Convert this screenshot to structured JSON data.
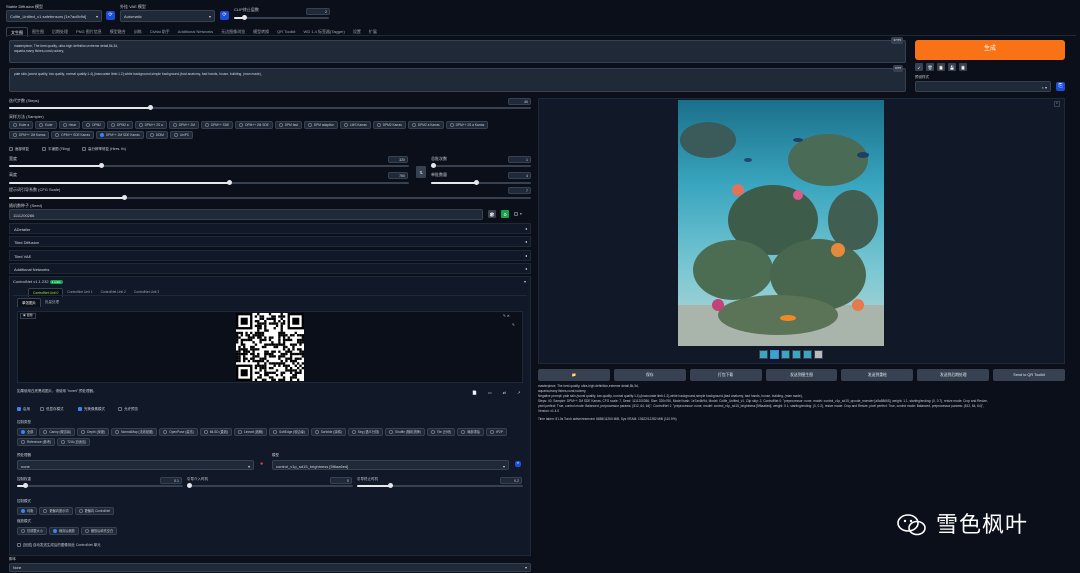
{
  "top": {
    "checkpoint_label": "Stable Diffusion 模型",
    "checkpoint_value": "Colife_Unified_v1.safetensors [1e7ac6b9d]",
    "vae_label": "外挂 VAE 模型",
    "vae_value": "Automatic",
    "clip_label": "CLIP终止层数",
    "clip_value": "2"
  },
  "tabs": [
    "文生图",
    "图生图",
    "后期处理",
    "PNG 图片信息",
    "模型融合",
    "训练",
    "Civitai 助手",
    "Additional Networks",
    "无边图像浏览",
    "模型转换",
    "QR Toolkit",
    "WD 1.4 标签器(Tagger)",
    "设置",
    "扩展"
  ],
  "prompt": {
    "positive": "masterpiece, The best quality, ultra-high definition,extreme detail,8k,3d,\naquaria,many fishes,coral,rockery,",
    "positive_count": "37/75",
    "negative": "pale skin,(worst quality, low quality, normal quality:1.4),(inaccurate limb:1.2),white background,simple background,(bad anatomy, bad hands, house, building, (man made),",
    "negative_count": "0/75",
    "generate": "生成",
    "style_label": "预设样式",
    "tool_icons": [
      "↙",
      "🗑",
      "📋",
      "💾",
      "📋"
    ]
  },
  "params": {
    "steps_label": "迭代步数 (Steps)",
    "steps_value": "40",
    "steps_ratio": 0.27,
    "sampler_label": "采样方法 (Sampler)",
    "samplers": [
      "Euler a",
      "Euler",
      "Heun",
      "DPM2",
      "DPM2 a",
      "DPM++ 2S a",
      "DPM++ 2M",
      "DPM++ SDE",
      "DPM++ 2M SDE",
      "DPM fast",
      "DPM adaptive",
      "LMS Karras",
      "DPM2 Karras",
      "DPM2 a Karras",
      "DPM++ 2S a Karras",
      "DPM++ 2M Karras",
      "DPM++ SDE Karras",
      "DPM++ 2M SDE Karras",
      "DDIM",
      "UniPC"
    ],
    "sampler_selected": "DPM++ 2M SDE Karras",
    "face_fix": "面部修复",
    "tiling": "平铺图 (Tiling)",
    "hires": "高分辨率修复 (Hires. fix)",
    "width_label": "宽度",
    "width_value": "320",
    "width_ratio": 0.23,
    "height_label": "高度",
    "height_value": "760",
    "height_ratio": 0.55,
    "batch_count_label": "总批次数",
    "batch_count_value": "1",
    "batch_size_label": "单批数量",
    "batch_size_value": "4",
    "batch_size_ratio": 0.45,
    "cfg_label": "提示词引导系数 (CFG Scale)",
    "cfg_value": "7",
    "cfg_ratio": 0.22,
    "seed_label": "随机数种子 (Seed)",
    "seed_value": "1111200286"
  },
  "accordions": [
    "ADetailer",
    "Tiled Diffusion",
    "Tiled VAE",
    "Additional Networks"
  ],
  "controlnet": {
    "title": "ControlNet v1.1.232",
    "badge": "1 units",
    "units": [
      "ControlNet Unit 0",
      "ControlNet Unit 1",
      "ControlNet Unit 2",
      "ControlNet Unit 3"
    ],
    "subtabs": [
      "单张图片",
      "批量处理"
    ],
    "image_label": "图像",
    "hint": "如果使用白底黑线图片，请使用 \"invert\" 预处理器。",
    "enable": "启用",
    "lowvram": "低显存模式",
    "pixel_perfect": "完美像素模式",
    "allow_preview": "允许预览",
    "control_type_label": "控制类型",
    "control_types": [
      "全部",
      "Canny (硬边缘)",
      "Depth (深度)",
      "NormalMap (法线贴图)",
      "OpenPose (姿态)",
      "MLSD (直线)",
      "Lineart (线稿)",
      "SoftEdge (软边缘)",
      "Scribble (涂鸦)",
      "Seg (语义分割)",
      "Shuffle (随机洗牌)",
      "Tile (分块)",
      "局部重绘",
      "IP2P",
      "Reference (参考)",
      "T2IA (自适应)"
    ],
    "preprocessor_label": "预处理器",
    "preprocessor_value": "none",
    "model_label": "模型",
    "model_value": "control_v1p_sd15_brightness [5f6aa6ed]",
    "weight_label": "控制权重",
    "weight_value": "0.1",
    "start_label": "引导介入时机",
    "start_value": "0",
    "end_label": "引导终止时机",
    "end_value": "0.2",
    "mode_label": "控制模式",
    "modes": [
      "均衡",
      "更偏向提示词",
      "更偏向 ControlNet"
    ],
    "resize_label": "缩放模式",
    "resizes": [
      "仅调整大小",
      "裁剪后缩放",
      "缩放后填充空白"
    ],
    "loopback": "[回送] 自动发送生成后的图像到此 ControlNet 单元"
  },
  "script": {
    "label": "脚本",
    "value": "None"
  },
  "output": {
    "buttons": [
      "📁",
      "保存",
      "打包下载",
      "发送到图生图",
      "发送到重绘",
      "发送到后期处理",
      "Send to QR Toolkit"
    ],
    "info_lines": [
      "masterpiece, The best quality, ultra-high definition,extreme detail,8k,3d,",
      "aquaria,many fishes,coral,rockery,",
      "Negative prompt: pale skin,(worst quality, low quality, normal quality:1.4),(inaccurate limb:1.2),white background,simple background,(bad anatomy, bad hands, house, building, (man made),",
      "Steps: 40, Sampler: DPM++ 2M SDE Karras, CFG scale: 7, Seed: 1111200286, Size: 320x760, Model hash: 1e7ac6b9d, Model: Colife_Unified_v1, Clip skip: 2, ControlNet 0: \"preprocessor: none, model: control_v1p_sd15_qrcode_monster [a5a58665], weight: 1.1, starting/ending: (0, 0.7), resize mode: Crop and Resize,",
      "pixel perfect: True, control mode: Balanced, preprocessor params: (512, 64, 64)\", ControlNet 1: \"preprocessor: none, model: control_v1p_sd15_brightness [5f6aa6ed], weight: 0.1, starting/ending: (0, 0.2), resize mode: Crop and Resize, pixel perfect: True, control mode: Balanced, preprocessor params: (512, 64, 64)\",",
      "Version: v1.4.0",
      "Time taken: 51.0s  Torch active/reserved: 6658/11260 MiB, Sys VRAM: 13622/12282 MiB (110.9%)"
    ]
  },
  "watermark": "雪色枫叶",
  "colors": {
    "accent": "#f97316",
    "blue": "#3b82f6",
    "bg": "#0b0f19"
  }
}
